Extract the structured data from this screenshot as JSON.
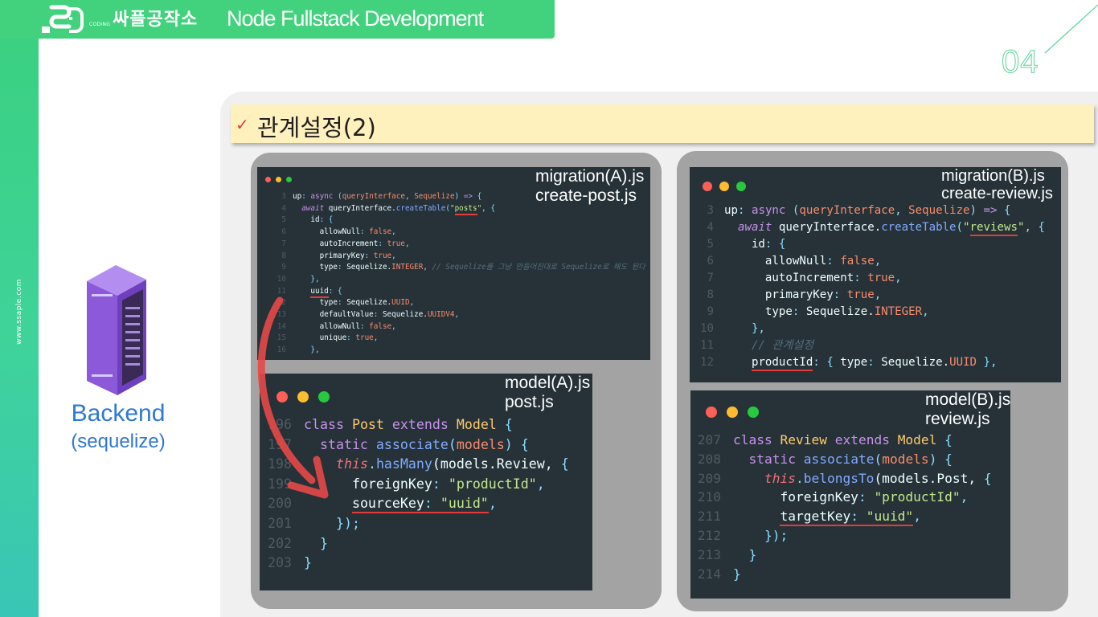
{
  "header": {
    "title": "Node Fullstack Development"
  },
  "logo": {
    "text": "싸플공작소",
    "small": "CODING"
  },
  "sidebar": {
    "url": "www.ssaple.com"
  },
  "slide": {
    "number": "04"
  },
  "section": {
    "title": "관계설정(2)"
  },
  "left": {
    "label": "Backend",
    "sublabel": "(sequelize)"
  },
  "colors": {
    "accent": "#42d17d",
    "highlight": "#e23c3c",
    "label_blue": "#2f78d2",
    "code_bg": "#263238"
  },
  "icons": [
    "check-icon",
    "server-rack-icon",
    "curved-arrow-icon",
    "window-dots-icon"
  ],
  "windows": {
    "migration_a": {
      "label1": "migration(A).js",
      "label2": "create-post.js",
      "lines": [
        {
          "n": "3",
          "code": [
            {
              "c": "t-plain",
              "t": "up"
            },
            {
              "c": "t-op",
              "t": ": "
            },
            {
              "c": "t-kw",
              "t": "async "
            },
            {
              "c": "t-punc",
              "t": "("
            },
            {
              "c": "t-param",
              "t": "queryInterface"
            },
            {
              "c": "t-punc",
              "t": ", "
            },
            {
              "c": "t-param",
              "t": "Sequelize"
            },
            {
              "c": "t-punc",
              "t": ") "
            },
            {
              "c": "t-kw",
              "t": "=> "
            },
            {
              "c": "t-punc",
              "t": "{"
            }
          ]
        },
        {
          "n": "4",
          "code": [
            {
              "c": "t-plain",
              "t": "  "
            },
            {
              "c": "t-kw-it",
              "t": "await "
            },
            {
              "c": "t-plain",
              "t": "queryInterface."
            },
            {
              "c": "t-fn",
              "t": "createTable"
            },
            {
              "c": "t-punc",
              "t": "("
            },
            {
              "c": "t-str",
              "t": "\""
            },
            {
              "c": "t-str hl",
              "t": "posts"
            },
            {
              "c": "t-str",
              "t": "\""
            },
            {
              "c": "t-punc",
              "t": ", {"
            }
          ]
        },
        {
          "n": "5",
          "code": [
            {
              "c": "t-plain",
              "t": "    id"
            },
            {
              "c": "t-op",
              "t": ": "
            },
            {
              "c": "t-punc",
              "t": "{"
            }
          ]
        },
        {
          "n": "6",
          "code": [
            {
              "c": "t-plain",
              "t": "      allowNull"
            },
            {
              "c": "t-op",
              "t": ": "
            },
            {
              "c": "t-bool",
              "t": "false"
            },
            {
              "c": "t-punc",
              "t": ","
            }
          ]
        },
        {
          "n": "7",
          "code": [
            {
              "c": "t-plain",
              "t": "      autoIncrement"
            },
            {
              "c": "t-op",
              "t": ": "
            },
            {
              "c": "t-bool",
              "t": "true"
            },
            {
              "c": "t-punc",
              "t": ","
            }
          ]
        },
        {
          "n": "8",
          "code": [
            {
              "c": "t-plain",
              "t": "      primaryKey"
            },
            {
              "c": "t-op",
              "t": ": "
            },
            {
              "c": "t-bool",
              "t": "true"
            },
            {
              "c": "t-punc",
              "t": ","
            }
          ]
        },
        {
          "n": "9",
          "code": [
            {
              "c": "t-plain",
              "t": "      type"
            },
            {
              "c": "t-op",
              "t": ": "
            },
            {
              "c": "t-plain",
              "t": "Sequelize."
            },
            {
              "c": "t-const",
              "t": "INTEGER"
            },
            {
              "c": "t-punc",
              "t": ", "
            },
            {
              "c": "t-cmt",
              "t": "// Sequelize를 그냥 만들어진대로 Sequelize로 해도 된다"
            }
          ]
        },
        {
          "n": "10",
          "code": [
            {
              "c": "t-punc",
              "t": "    },"
            }
          ]
        },
        {
          "n": "11",
          "code": [
            {
              "c": "t-plain",
              "t": "    "
            },
            {
              "c": "t-plain hl",
              "t": "uuid"
            },
            {
              "c": "t-op",
              "t": ": "
            },
            {
              "c": "t-punc",
              "t": "{"
            }
          ]
        },
        {
          "n": "12",
          "code": [
            {
              "c": "t-plain",
              "t": "      type"
            },
            {
              "c": "t-op",
              "t": ": "
            },
            {
              "c": "t-plain",
              "t": "Sequelize."
            },
            {
              "c": "t-const",
              "t": "UUID"
            },
            {
              "c": "t-punc",
              "t": ","
            }
          ]
        },
        {
          "n": "13",
          "code": [
            {
              "c": "t-plain",
              "t": "      defaultValue"
            },
            {
              "c": "t-op",
              "t": ": "
            },
            {
              "c": "t-plain",
              "t": "Sequelize."
            },
            {
              "c": "t-const",
              "t": "UUIDV4"
            },
            {
              "c": "t-punc",
              "t": ","
            }
          ]
        },
        {
          "n": "14",
          "code": [
            {
              "c": "t-plain",
              "t": "      allowNull"
            },
            {
              "c": "t-op",
              "t": ": "
            },
            {
              "c": "t-bool",
              "t": "false"
            },
            {
              "c": "t-punc",
              "t": ","
            }
          ]
        },
        {
          "n": "15",
          "code": [
            {
              "c": "t-plain",
              "t": "      unique"
            },
            {
              "c": "t-op",
              "t": ": "
            },
            {
              "c": "t-bool",
              "t": "true"
            },
            {
              "c": "t-punc",
              "t": ","
            }
          ]
        },
        {
          "n": "16",
          "code": [
            {
              "c": "t-punc",
              "t": "    },"
            }
          ]
        }
      ]
    },
    "model_a": {
      "label1": "model(A).js",
      "label2": "post.js",
      "lines": [
        {
          "n": "196",
          "code": [
            {
              "c": "t-kw",
              "t": "class "
            },
            {
              "c": "t-cls",
              "t": "Post "
            },
            {
              "c": "t-kw",
              "t": "extends "
            },
            {
              "c": "t-cls",
              "t": "Model "
            },
            {
              "c": "t-punc",
              "t": "{"
            }
          ]
        },
        {
          "n": "197",
          "code": [
            {
              "c": "t-plain",
              "t": "  "
            },
            {
              "c": "t-kw",
              "t": "static "
            },
            {
              "c": "t-fn",
              "t": "associate"
            },
            {
              "c": "t-punc",
              "t": "("
            },
            {
              "c": "t-param",
              "t": "models"
            },
            {
              "c": "t-punc",
              "t": ") {"
            }
          ]
        },
        {
          "n": "198",
          "code": [
            {
              "c": "t-plain",
              "t": "    "
            },
            {
              "c": "t-this",
              "t": "this"
            },
            {
              "c": "t-punc",
              "t": "."
            },
            {
              "c": "t-fn",
              "t": "hasMany"
            },
            {
              "c": "t-plain",
              "t": "(models.Review, "
            },
            {
              "c": "t-punc",
              "t": "{"
            }
          ]
        },
        {
          "n": "199",
          "code": [
            {
              "c": "t-plain",
              "t": "      foreignKey"
            },
            {
              "c": "t-op",
              "t": ": "
            },
            {
              "c": "t-str",
              "t": "\"productId\""
            },
            {
              "c": "t-punc",
              "t": ","
            }
          ]
        },
        {
          "n": "200",
          "code": [
            {
              "c": "t-plain",
              "t": "      "
            },
            {
              "c": "t-plain hl",
              "t": "sourceKey"
            },
            {
              "c": "t-op hl",
              "t": ": "
            },
            {
              "c": "t-str hl",
              "t": "\"uuid\""
            },
            {
              "c": "t-punc",
              "t": ","
            }
          ]
        },
        {
          "n": "201",
          "code": [
            {
              "c": "t-punc",
              "t": "    });"
            }
          ]
        },
        {
          "n": "202",
          "code": [
            {
              "c": "t-punc",
              "t": "  }"
            }
          ]
        },
        {
          "n": "203",
          "code": [
            {
              "c": "t-punc",
              "t": "}"
            }
          ]
        }
      ]
    },
    "migration_b": {
      "label1": "migration(B).js",
      "label2": "create-review.js",
      "lines": [
        {
          "n": "3",
          "code": [
            {
              "c": "t-plain",
              "t": "up"
            },
            {
              "c": "t-op",
              "t": ": "
            },
            {
              "c": "t-kw",
              "t": "async "
            },
            {
              "c": "t-punc",
              "t": "("
            },
            {
              "c": "t-param",
              "t": "queryInterface"
            },
            {
              "c": "t-punc",
              "t": ", "
            },
            {
              "c": "t-param",
              "t": "Sequelize"
            },
            {
              "c": "t-punc",
              "t": ") "
            },
            {
              "c": "t-kw",
              "t": "=> "
            },
            {
              "c": "t-punc",
              "t": "{"
            }
          ]
        },
        {
          "n": "4",
          "code": [
            {
              "c": "t-plain",
              "t": "  "
            },
            {
              "c": "t-kw-it",
              "t": "await "
            },
            {
              "c": "t-plain",
              "t": "queryInterface."
            },
            {
              "c": "t-fn",
              "t": "createTable"
            },
            {
              "c": "t-punc",
              "t": "("
            },
            {
              "c": "t-str",
              "t": "\""
            },
            {
              "c": "t-str hl",
              "t": "reviews"
            },
            {
              "c": "t-str",
              "t": "\""
            },
            {
              "c": "t-punc",
              "t": ", {"
            }
          ]
        },
        {
          "n": "5",
          "code": [
            {
              "c": "t-plain",
              "t": "    id"
            },
            {
              "c": "t-op",
              "t": ": "
            },
            {
              "c": "t-punc",
              "t": "{"
            }
          ]
        },
        {
          "n": "6",
          "code": [
            {
              "c": "t-plain",
              "t": "      allowNull"
            },
            {
              "c": "t-op",
              "t": ": "
            },
            {
              "c": "t-bool",
              "t": "false"
            },
            {
              "c": "t-punc",
              "t": ","
            }
          ]
        },
        {
          "n": "7",
          "code": [
            {
              "c": "t-plain",
              "t": "      autoIncrement"
            },
            {
              "c": "t-op",
              "t": ": "
            },
            {
              "c": "t-bool",
              "t": "true"
            },
            {
              "c": "t-punc",
              "t": ","
            }
          ]
        },
        {
          "n": "8",
          "code": [
            {
              "c": "t-plain",
              "t": "      primaryKey"
            },
            {
              "c": "t-op",
              "t": ": "
            },
            {
              "c": "t-bool",
              "t": "true"
            },
            {
              "c": "t-punc",
              "t": ","
            }
          ]
        },
        {
          "n": "9",
          "code": [
            {
              "c": "t-plain",
              "t": "      type"
            },
            {
              "c": "t-op",
              "t": ": "
            },
            {
              "c": "t-plain",
              "t": "Sequelize."
            },
            {
              "c": "t-const",
              "t": "INTEGER"
            },
            {
              "c": "t-punc",
              "t": ","
            }
          ]
        },
        {
          "n": "10",
          "code": [
            {
              "c": "t-punc",
              "t": "    },"
            }
          ]
        },
        {
          "n": "11",
          "code": [
            {
              "c": "t-cmt",
              "t": "    // 관계설정"
            }
          ]
        },
        {
          "n": "12",
          "code": [
            {
              "c": "t-plain",
              "t": "    "
            },
            {
              "c": "t-plain hl",
              "t": "productId"
            },
            {
              "c": "t-op",
              "t": ": "
            },
            {
              "c": "t-punc",
              "t": "{ "
            },
            {
              "c": "t-plain",
              "t": "type"
            },
            {
              "c": "t-op",
              "t": ": "
            },
            {
              "c": "t-plain",
              "t": "Sequelize."
            },
            {
              "c": "t-const",
              "t": "UUID"
            },
            {
              "c": "t-punc",
              "t": " },"
            }
          ]
        }
      ]
    },
    "model_b": {
      "label1": "model(B).js",
      "label2": "review.js",
      "lines": [
        {
          "n": "207",
          "code": [
            {
              "c": "t-kw",
              "t": "class "
            },
            {
              "c": "t-cls",
              "t": "Review "
            },
            {
              "c": "t-kw",
              "t": "extends "
            },
            {
              "c": "t-cls",
              "t": "Model "
            },
            {
              "c": "t-punc",
              "t": "{"
            }
          ]
        },
        {
          "n": "208",
          "code": [
            {
              "c": "t-plain",
              "t": "  "
            },
            {
              "c": "t-kw",
              "t": "static "
            },
            {
              "c": "t-fn",
              "t": "associate"
            },
            {
              "c": "t-punc",
              "t": "("
            },
            {
              "c": "t-param",
              "t": "models"
            },
            {
              "c": "t-punc",
              "t": ") {"
            }
          ]
        },
        {
          "n": "209",
          "code": [
            {
              "c": "t-plain",
              "t": "    "
            },
            {
              "c": "t-this",
              "t": "this"
            },
            {
              "c": "t-punc",
              "t": "."
            },
            {
              "c": "t-fn",
              "t": "belongsTo"
            },
            {
              "c": "t-plain",
              "t": "(models.Post, "
            },
            {
              "c": "t-punc",
              "t": "{"
            }
          ]
        },
        {
          "n": "210",
          "code": [
            {
              "c": "t-plain",
              "t": "      foreignKey"
            },
            {
              "c": "t-op",
              "t": ": "
            },
            {
              "c": "t-str",
              "t": "\"productId\""
            },
            {
              "c": "t-punc",
              "t": ","
            }
          ]
        },
        {
          "n": "211",
          "code": [
            {
              "c": "t-plain",
              "t": "      "
            },
            {
              "c": "t-plain hl",
              "t": "targetKey"
            },
            {
              "c": "t-op hl",
              "t": ": "
            },
            {
              "c": "t-str hl",
              "t": "\"uuid\""
            },
            {
              "c": "t-punc",
              "t": ","
            }
          ]
        },
        {
          "n": "212",
          "code": [
            {
              "c": "t-punc",
              "t": "    });"
            }
          ]
        },
        {
          "n": "213",
          "code": [
            {
              "c": "t-punc",
              "t": "  }"
            }
          ]
        },
        {
          "n": "214",
          "code": [
            {
              "c": "t-punc",
              "t": "}"
            }
          ]
        }
      ]
    }
  }
}
